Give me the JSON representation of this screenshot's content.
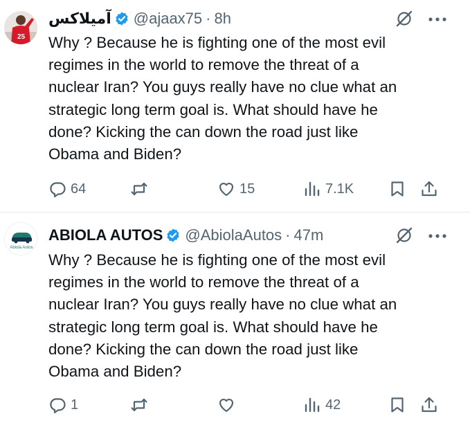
{
  "tweets": [
    {
      "display_name": "آمیلاکس",
      "handle": "@ajaax75",
      "separator": "·",
      "time": "8h",
      "text": "Why ? Because he is fighting one of the most evil\nregimes in the world to remove the threat of a\nnuclear Iran? You guys really have no clue what an\nstrategic long term goal is. What should have he\ndone? Kicking the can down the road just like\nObama and Biden?",
      "avatar_jersey_number": "25",
      "replies": "64",
      "retweets": "",
      "likes": "15",
      "views": "7.1K"
    },
    {
      "display_name": "ABIOLA AUTOS",
      "handle": "@AbiolaAutos",
      "separator": "·",
      "time": "47m",
      "text": "Why ? Because he is fighting one of the most evil\nregimes in the world to remove the threat of a\nnuclear Iran? You guys really have no clue what an\nstrategic long term goal is. What should have he\ndone? Kicking the can down the road just like\nObama and Biden?",
      "avatar_logo_text": "Abiola Autos",
      "replies": "1",
      "retweets": "",
      "likes": "",
      "views": "42"
    }
  ],
  "colors": {
    "text": "#0f1419",
    "muted": "#536471",
    "verified": "#1d9bf0",
    "divider": "#e7e9ea"
  },
  "icons": [
    "verified-badge-icon",
    "grok-icon",
    "more-icon",
    "reply-icon",
    "retweet-icon",
    "like-icon",
    "views-icon",
    "bookmark-icon",
    "share-icon"
  ]
}
